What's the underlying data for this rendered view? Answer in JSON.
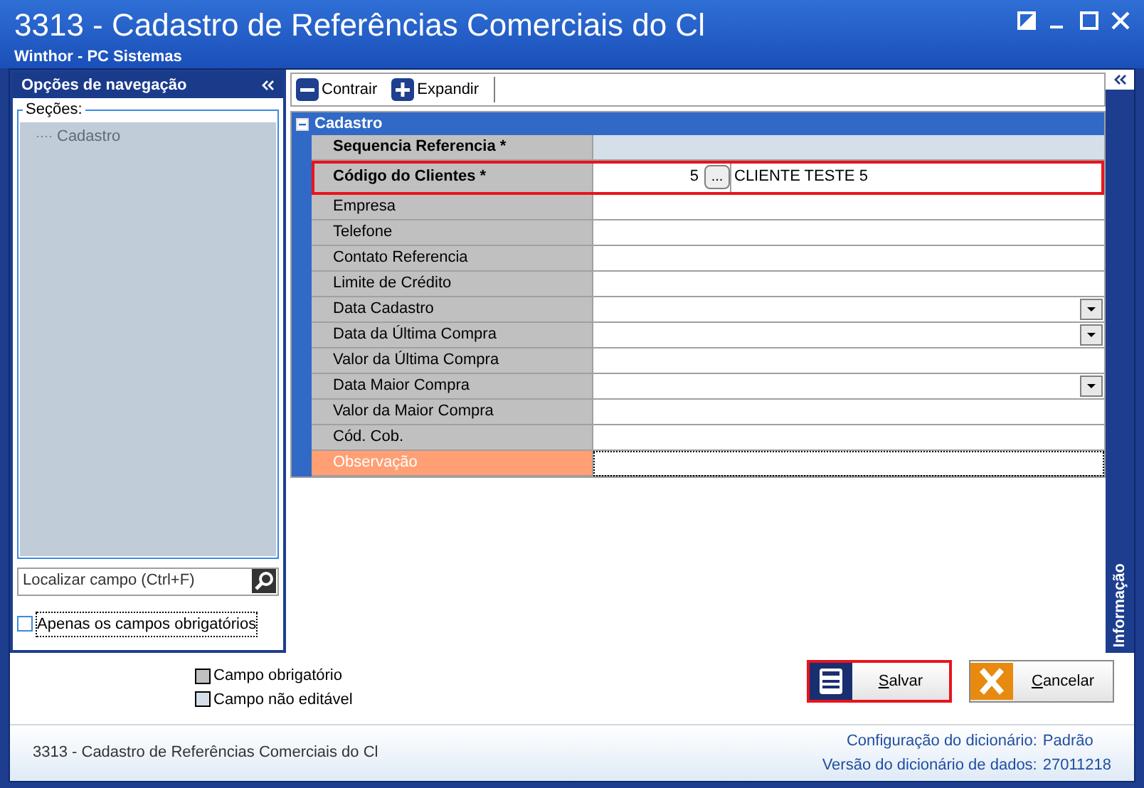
{
  "window": {
    "title": "3313 - Cadastro de Referências Comerciais do Cl",
    "subtitle": "Winthor - PC Sistemas"
  },
  "navigation": {
    "title": "Opções de navegação",
    "sections_label": "Seções:",
    "items": [
      {
        "label": "Cadastro",
        "selected": false
      }
    ],
    "search": {
      "placeholder": "Localizar campo (Ctrl+F)"
    },
    "required_only": {
      "label": "Apenas os campos obrigatórios",
      "checked": false
    }
  },
  "toolbar": [
    {
      "label": "Contrair",
      "kind": "collapse"
    },
    {
      "label": "Expandir",
      "kind": "expand"
    }
  ],
  "group": {
    "title": "Cadastro",
    "expanded": true,
    "rows": [
      {
        "label": "Sequencia Referencia *",
        "required": true,
        "kind": "readonly",
        "outlined": false,
        "focused": false
      },
      {
        "label": "Código do Clientes *",
        "required": true,
        "kind": "lookup",
        "code": "5",
        "button": "...",
        "name": "CLIENTE TESTE 5",
        "outlined": true,
        "focused": false
      },
      {
        "label": "Empresa",
        "required": false,
        "kind": "text",
        "outlined": false,
        "focused": false
      },
      {
        "label": "Telefone",
        "required": false,
        "kind": "text",
        "outlined": false,
        "focused": false
      },
      {
        "label": "Contato Referencia",
        "required": false,
        "kind": "text",
        "outlined": false,
        "focused": false
      },
      {
        "label": "Limite de Crédito",
        "required": false,
        "kind": "text",
        "outlined": false,
        "focused": false
      },
      {
        "label": "Data Cadastro",
        "required": false,
        "kind": "date",
        "outlined": false,
        "focused": false
      },
      {
        "label": "Data da Última Compra",
        "required": false,
        "kind": "date",
        "outlined": false,
        "focused": false
      },
      {
        "label": "Valor da Última Compra",
        "required": false,
        "kind": "text",
        "outlined": false,
        "focused": false
      },
      {
        "label": "Data Maior Compra",
        "required": false,
        "kind": "date",
        "outlined": false,
        "focused": false
      },
      {
        "label": "Valor da Maior Compra",
        "required": false,
        "kind": "text",
        "outlined": false,
        "focused": false
      },
      {
        "label": "Cód. Cob.",
        "required": false,
        "kind": "text",
        "outlined": false,
        "focused": false
      },
      {
        "label": "Observação",
        "required": false,
        "kind": "text",
        "outlined": false,
        "focused": true
      }
    ]
  },
  "info_tab": "Informação",
  "legend": [
    {
      "label": "Campo obrigatório",
      "color": "#c0c0c0"
    },
    {
      "label": "Campo não editável",
      "color": "#d4dfe9"
    }
  ],
  "buttons": [
    {
      "label": "Salvar",
      "kind": "save",
      "outlined": true
    },
    {
      "label": "Cancelar",
      "kind": "cancel",
      "outlined": false
    }
  ],
  "status": {
    "title": "3313 - Cadastro de Referências Comerciais do Cl",
    "config_label": "Configuração do dicionário:",
    "config_value": "Padrão",
    "version_label": "Versão do dicionário de dados:",
    "version_value": "27011218"
  }
}
